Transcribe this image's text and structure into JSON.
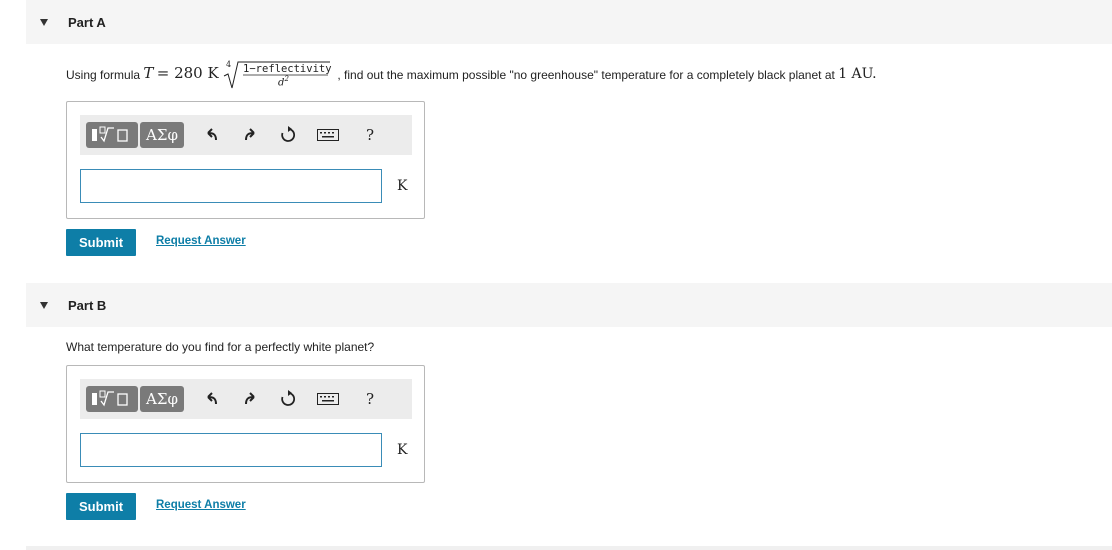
{
  "partA": {
    "title": "Part A",
    "question_prefix": "Using formula",
    "formula_T": "T",
    "formula_eq": "= 280 K",
    "root_index": "4",
    "numerator": "1−reflectivity",
    "denominator": "d",
    "denominator_exp": "2",
    "question_suffix": ", find out the maximum possible \"no greenhouse\" temperature for a completely black planet at",
    "question_end": "1 AU.",
    "greek_label": "ΑΣφ",
    "help_label": "?",
    "answer_value": "",
    "unit": "K",
    "submit_label": "Submit",
    "request_label": "Request Answer"
  },
  "partB": {
    "title": "Part B",
    "question": "What temperature do you find for a perfectly white planet?",
    "greek_label": "ΑΣφ",
    "help_label": "?",
    "answer_value": "",
    "unit": "K",
    "submit_label": "Submit",
    "request_label": "Request Answer"
  },
  "icons": {
    "toggle": "caret-down-icon",
    "templates": "templates-icon",
    "undo": "undo-icon",
    "redo": "redo-icon",
    "reset": "reset-icon",
    "keyboard": "keyboard-icon"
  }
}
